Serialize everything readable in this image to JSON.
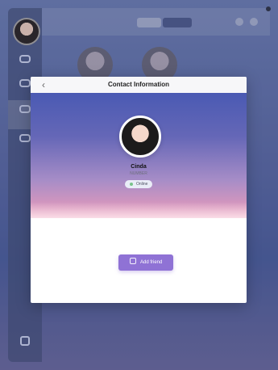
{
  "modal": {
    "title": "Contact Information",
    "back_icon": "chevron-left-icon"
  },
  "profile": {
    "name": "Cinda",
    "subtext": "NUMBER",
    "status": "Online"
  },
  "actions": {
    "add_friend": "Add friend"
  },
  "colors": {
    "accent": "#8f72d5"
  }
}
